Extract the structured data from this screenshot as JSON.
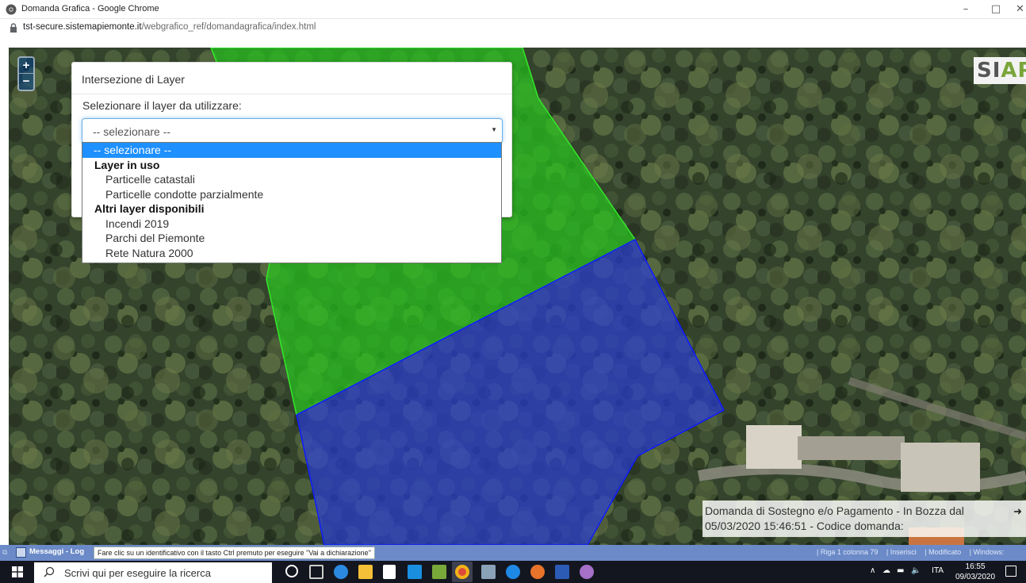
{
  "browser": {
    "window_title": "Domanda Grafica - Google Chrome",
    "url_host": "tst-secure.sistemapiemonte.it",
    "url_path": "/webgrafico_ref/domandagrafica/index.html",
    "minimize_label": "–",
    "maximize_label": "□",
    "close_label": "✕"
  },
  "map": {
    "zoom_in": "+",
    "zoom_out": "−",
    "logo_left": "SI",
    "logo_right": "AP",
    "polygon_colors": {
      "green": "#27c31f",
      "blue": "#2b3fd0"
    },
    "info_line1": "Domanda di Sostegno e/o Pagamento - In Bozza dal",
    "info_line2": "05/03/2020 15:46:51 - Codice domanda:",
    "info_arrow": "➜"
  },
  "dialog": {
    "title": "Intersezione di Layer",
    "prompt": "Selezionare il layer da utilizzare:",
    "select_value": "-- selezionare --",
    "caret": "▼"
  },
  "dropdown": {
    "selected": "-- selezionare --",
    "group1": "Layer in uso",
    "group1_items": [
      "Particelle catastali",
      "Particelle condotte parzialmente"
    ],
    "group2": "Altri layer disponibili",
    "group2_items": [
      "Incendi 2019",
      "Parchi del Piemonte",
      "Rete Natura 2000"
    ]
  },
  "statusbar": {
    "messages_tab": "Messaggi - Log",
    "hint": "Fare clic su un identificativo con il tasto Ctrl premuto per eseguire \"Vai a dichiarazione\"",
    "row_col": "| Riga 1 colonna 79",
    "mode": "| Inserisci",
    "modified": "| Modificato",
    "eol": "| Windows:"
  },
  "taskbar": {
    "search_placeholder": "Scrivi qui per eseguire la ricerca",
    "lang": "ITA",
    "time": "16:55",
    "date": "09/03/2020",
    "tray_chevron": "∧"
  }
}
